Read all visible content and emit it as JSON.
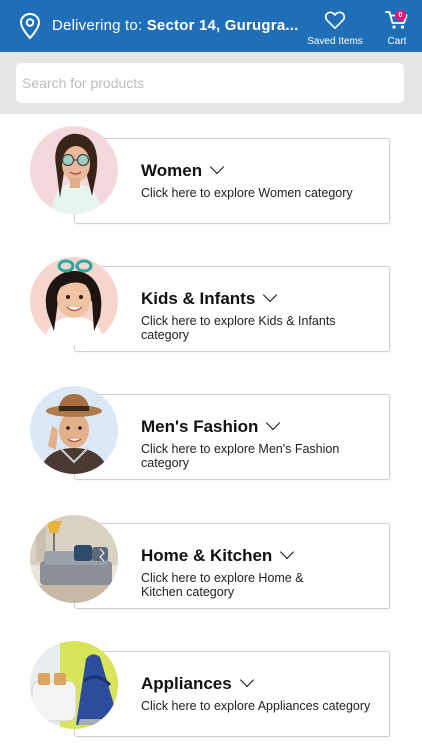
{
  "header": {
    "delivering_label": "Delivering to:",
    "location": "Sector 14, Gurugra...",
    "saved_label": "Saved Items",
    "cart_label": "Cart",
    "cart_count": "0",
    "bar_color": "#1f6fb8"
  },
  "search": {
    "placeholder": "Search for products",
    "value": ""
  },
  "categories": [
    {
      "title": "Women",
      "subtitle": "Click here to explore Women category",
      "image": "woman-with-sunglasses-photo"
    },
    {
      "title": "Kids & Infants",
      "subtitle": "Click here to explore Kids & Infants category",
      "image": "smiling-girl-photo"
    },
    {
      "title": "Men's Fashion",
      "subtitle": "Click here to explore Men's Fashion category",
      "image": "man-in-hat-photo"
    },
    {
      "title": "Home & Kitchen",
      "subtitle": "Click here to explore Home & Kitchen category",
      "image": "sofa-and-lamp-photo"
    },
    {
      "title": "Appliances",
      "subtitle": "Click here to explore Appliances category",
      "image": "toaster-and-iron-photo"
    }
  ]
}
